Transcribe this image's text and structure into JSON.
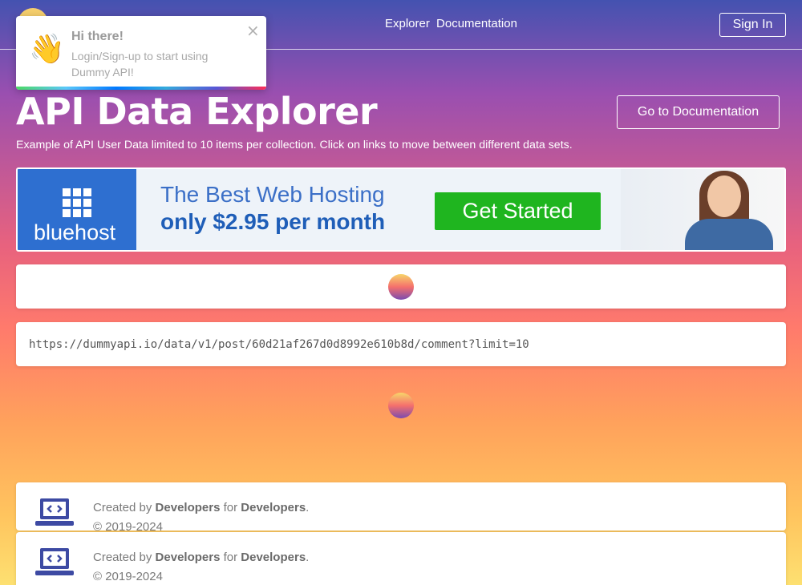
{
  "nav": {
    "links": [
      "Explorer",
      "Documentation"
    ],
    "signin_label": "Sign In"
  },
  "toast": {
    "icon": "waving-hand-icon",
    "title": "Hi there!",
    "body": "Login/Sign-up to start using Dummy API!",
    "close": "×"
  },
  "header": {
    "title": "API Data Explorer",
    "subtitle": "Example of API User Data limited to 10 items per collection. Click on links to move between different data sets.",
    "doc_button": "Go to Documentation"
  },
  "ad": {
    "brand": "bluehost",
    "headline": "The Best Web Hosting",
    "subline": "only  $2.95  per month",
    "cta": "Get Started",
    "colors": {
      "brand": "#2e6fd0",
      "cta": "#1fb51f"
    }
  },
  "request": {
    "url": "https://dummyapi.io/data/v1/post/60d21af267d0d8992e610b8d/comment?limit=10"
  },
  "footer": {
    "created_prefix": "Created by",
    "developers": "Developers",
    "for": "for",
    "developers2": "Developers",
    "period": ".",
    "copyright": "© 2019-2024"
  }
}
